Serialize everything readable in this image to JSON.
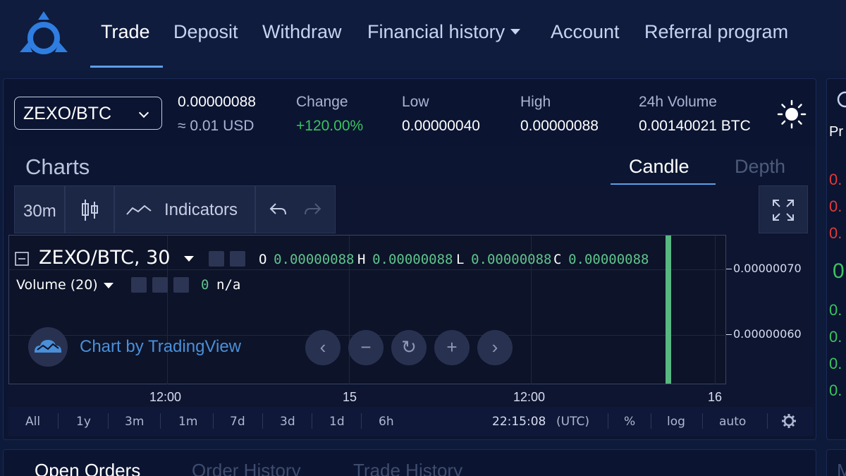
{
  "nav": {
    "items": [
      "Trade",
      "Deposit",
      "Withdraw",
      "Financial history",
      "Account",
      "Referral program"
    ],
    "active": "Trade"
  },
  "ticker": {
    "pair": "ZEXO/BTC",
    "last_price": "0.00000088",
    "usd_value": "≈ 0.01 USD",
    "change_label": "Change",
    "change_value": "+120.00%",
    "low_label": "Low",
    "low_value": "0.00000040",
    "high_label": "High",
    "high_value": "0.00000088",
    "volume_label": "24h Volume",
    "volume_value": "0.00140021 BTC"
  },
  "charts": {
    "title": "Charts",
    "tabs": [
      "Candle",
      "Depth"
    ],
    "active_tab": "Candle"
  },
  "toolbar": {
    "interval": "30m",
    "indicators": "Indicators"
  },
  "legend": {
    "symbol": "ZEXO/BTC, 30",
    "o_label": "O",
    "o_value": "0.00000088",
    "h_label": "H",
    "h_value": "0.00000088",
    "l_label": "L",
    "l_value": "0.00000088",
    "c_label": "C",
    "c_value": "0.00000088",
    "volume_label": "Volume (20)",
    "volume_value": "0",
    "volume_na": "n/a"
  },
  "watermark": "Chart by TradingView",
  "price_axis": [
    "0.00000070",
    "0.00000060"
  ],
  "time_axis": [
    "12:00",
    "15",
    "12:00",
    "16"
  ],
  "ranges": [
    "All",
    "1y",
    "3m",
    "1m",
    "7d",
    "3d",
    "1d",
    "6h"
  ],
  "clock": "22:15:08",
  "timezone": "(UTC)",
  "scale_options": [
    "%",
    "log",
    "auto"
  ],
  "right_col": {
    "header_partial": "Pr",
    "red_rows": [
      "0.",
      "0.",
      "0."
    ],
    "mid_partial": "0",
    "green_rows": [
      "0.",
      "0.",
      "0.",
      "0."
    ]
  },
  "bottom_tabs": [
    "Open Orders",
    "Order History",
    "Trade History"
  ],
  "bottom_right_partial": "M",
  "colors": {
    "accent": "#5d9ee8",
    "positive": "#3ac35f",
    "negative": "#e23a3a",
    "volume_bar": "#57b882"
  }
}
